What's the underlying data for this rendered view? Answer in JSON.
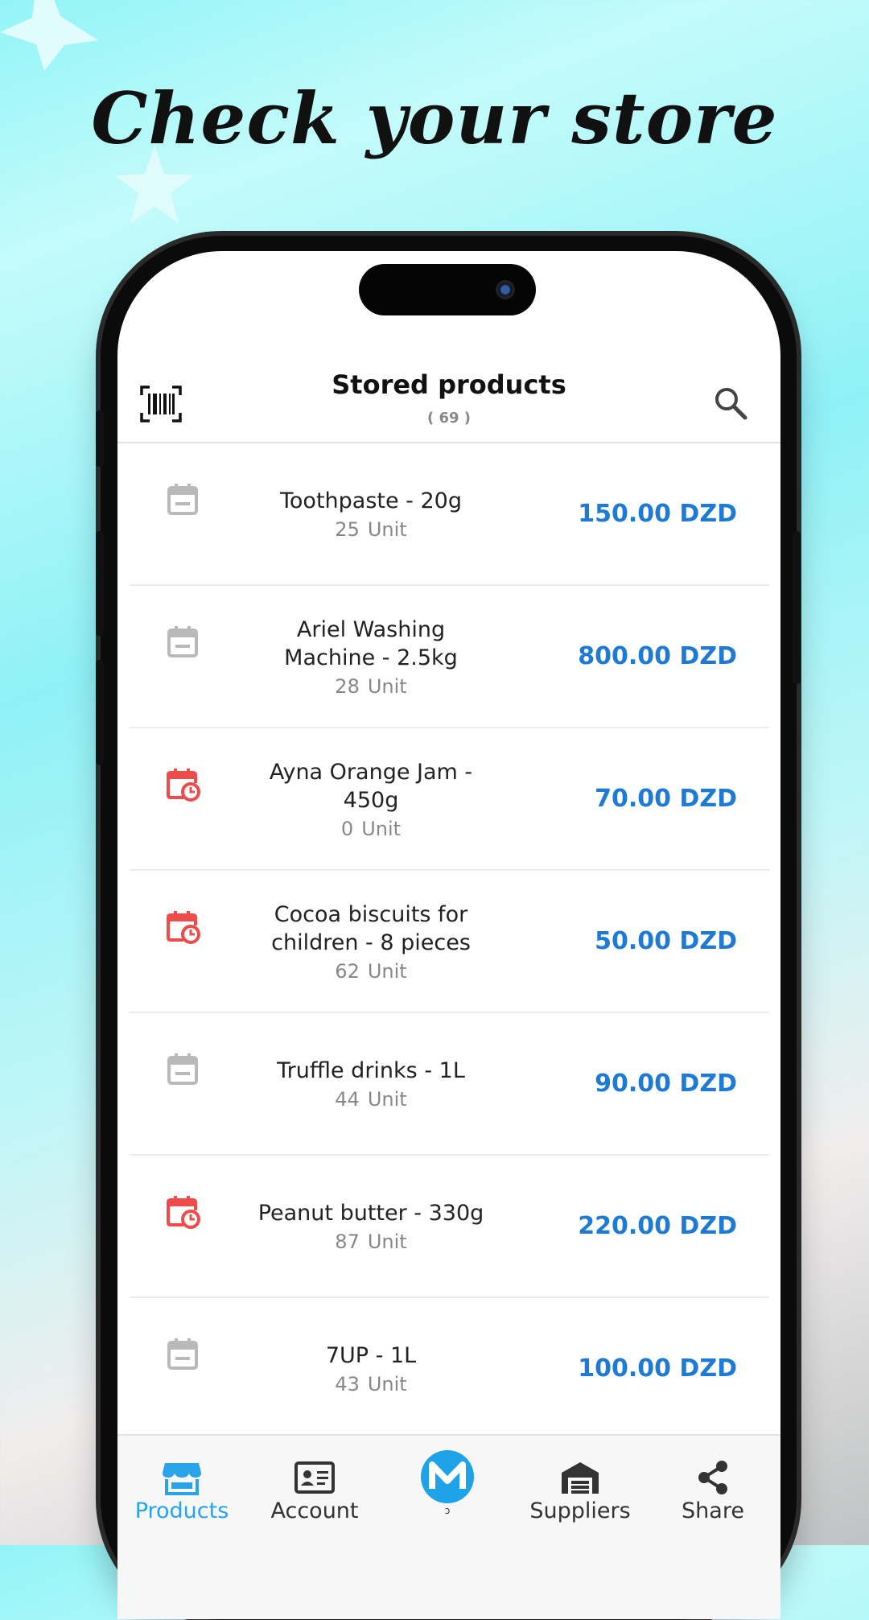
{
  "headline": "Check your store",
  "appbar": {
    "title": "Stored products",
    "count": "( 69 )",
    "left_icon": "barcode-scan-icon",
    "right_icon": "search-icon"
  },
  "colors": {
    "price": "#1e7ad3",
    "active_nav": "#29a3e9",
    "calendar_alert": "#ef4b4b",
    "calendar_normal": "#b9b9b9"
  },
  "products": [
    {
      "name": "Toothpaste - 20g",
      "qty": "25",
      "unit": "Unit",
      "price": "150.00 DZD",
      "icon": "calendar-icon"
    },
    {
      "name": "Ariel Washing Machine - 2.5kg",
      "qty": "28",
      "unit": "Unit",
      "price": "800.00 DZD",
      "icon": "calendar-icon"
    },
    {
      "name": "Ayna Orange Jam - 450g",
      "qty": "0",
      "unit": "Unit",
      "price": "70.00 DZD",
      "icon": "calendar-clock-icon"
    },
    {
      "name": "Cocoa biscuits for children - 8 pieces",
      "qty": "62",
      "unit": "Unit",
      "price": "50.00 DZD",
      "icon": "calendar-clock-icon"
    },
    {
      "name": "Truffle drinks - 1L",
      "qty": "44",
      "unit": "Unit",
      "price": "90.00 DZD",
      "icon": "calendar-icon"
    },
    {
      "name": "Peanut butter - 330g",
      "qty": "87",
      "unit": "Unit",
      "price": "220.00 DZD",
      "icon": "calendar-clock-icon"
    },
    {
      "name": "7UP - 1L",
      "qty": "43",
      "unit": "Unit",
      "price": "100.00 DZD",
      "icon": "calendar-icon"
    }
  ],
  "nav": {
    "products": "Products",
    "account": "Account",
    "center_sub": "ↄ",
    "suppliers": "Suppliers",
    "share": "Share"
  }
}
